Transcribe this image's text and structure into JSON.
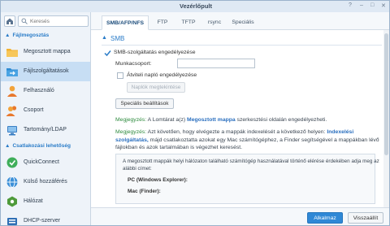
{
  "window": {
    "title": "Vezérlőpult"
  },
  "sidebar": {
    "search_placeholder": "Keresés",
    "section_file_sharing": "Fájlmegosztás",
    "section_connectivity": "Csatlakozási lehetőség",
    "items": [
      {
        "label": "Megosztott mappa",
        "icon": "folder-icon"
      },
      {
        "label": "Fájlszolgáltatások",
        "icon": "file-services-icon"
      },
      {
        "label": "Felhasználó",
        "icon": "user-icon"
      },
      {
        "label": "Csoport",
        "icon": "group-icon"
      },
      {
        "label": "Tartomány/LDAP",
        "icon": "domain-icon"
      },
      {
        "label": "QuickConnect",
        "icon": "quickconnect-icon"
      },
      {
        "label": "Külső hozzáférés",
        "icon": "external-access-icon"
      },
      {
        "label": "Hálózat",
        "icon": "network-icon"
      },
      {
        "label": "DHCP-szerver",
        "icon": "dhcp-icon"
      }
    ]
  },
  "tabs": [
    "SMB/AFP/NFS",
    "FTP",
    "TFTP",
    "rsync",
    "Speciális"
  ],
  "smb": {
    "header": "SMB",
    "enable_label": "SMB-szolgáltatás engedélyezése",
    "workgroup_label": "Munkacsoport:",
    "workgroup_value": "",
    "transfer_log_label": "Átviteli napló engedélyezése",
    "logs_button": "Naplók megtekintése",
    "advanced_button": "Speciális beállítások"
  },
  "notes": {
    "note1_prefix": "Megjegyzés:",
    "note1_text": " A Lomtárat a(z) ",
    "note1_link": "Megosztott mappa",
    "note1_suffix": " szerkesztési oldalán engedélyezheti.",
    "note2_prefix": "Megjegyzés:",
    "note2_text": " Azt követően, hogy elvégezte a mappák indexelését a következő helyen: ",
    "note2_link": "Indexelési szolgáltatás,",
    "note2_suffix": " májd csatlakoztatta azokat egy Mac számítógéphez, a Finder segítségével a mappákban lévő fájlokban és azok tartalmában is végezhet keresést."
  },
  "info": {
    "text": "A megosztott mappák helyi hálózaton található számítógép használatával történő elérése érdekében adja meg az alábbi címet:",
    "pc_label": "PC (Windows Explorer):",
    "mac_label": "Mac (Finder):"
  },
  "footer": {
    "apply": "Alkalmaz",
    "reset": "Visszaállít"
  },
  "colors": {
    "accent": "#2a7cc8",
    "primary_button": "#2f88d6",
    "active_sidebar": "#c7def4"
  }
}
